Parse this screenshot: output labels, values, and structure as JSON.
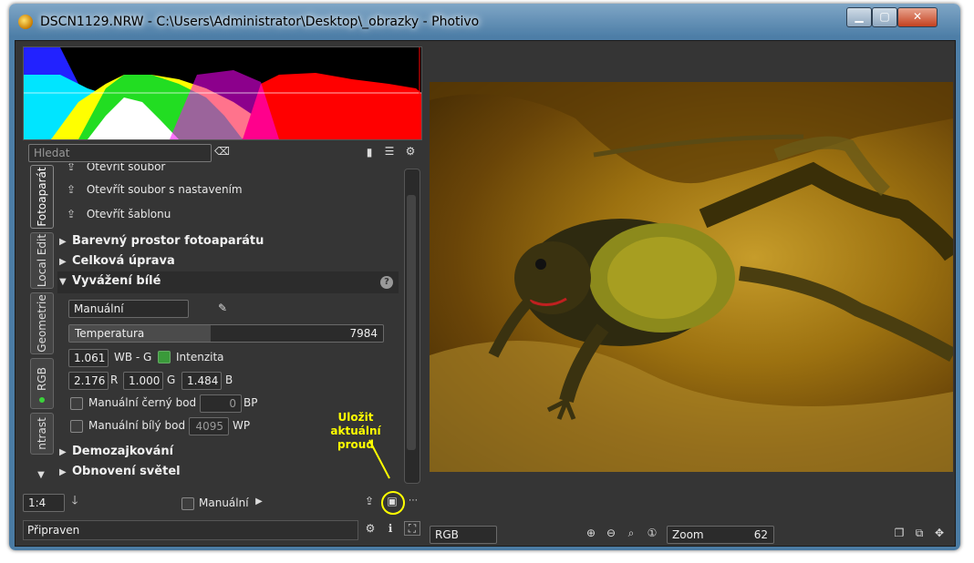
{
  "window": {
    "title": "DSCN1129.NRW - C:\\Users\\Administrator\\Desktop\\_obrazky - Photivo",
    "minimize": "▁",
    "maximize": "▢",
    "close": "✕"
  },
  "toolbar_top": {
    "search_placeholder": "Hledat"
  },
  "side_tabs": [
    "Fotoaparát",
    "Local Edit",
    "Geometrie",
    "RGB",
    "ntrast"
  ],
  "panel": {
    "open_file_partial": "Otevřít soubor",
    "open_with_settings": "Otevřít soubor s nastavením",
    "open_template": "Otevřít šablonu",
    "sections_top": [
      "Barevný prostor fotoaparátu",
      "Celková úprava"
    ],
    "white_balance": {
      "title": "Vyvážení bílé",
      "mode": "Manuální",
      "temperature_label": "Temperatura",
      "temperature_value": "7984",
      "temperature_level": 0.45,
      "wb_g_value": "1.061",
      "wb_g_label": "WB - G",
      "intensity_label": "Intenzita",
      "r_value": "2.176",
      "r_label": "R",
      "g_value": "1.000",
      "g_label": "G",
      "b_value": "1.484",
      "b_label": "B",
      "black_point_label": "Manuální černý bod",
      "black_point_value": "0",
      "black_point_unit": "BP",
      "white_point_label": "Manuální bílý bod",
      "white_point_value": "4095",
      "white_point_unit": "WP"
    },
    "sections_bottom": [
      "Demozajkování",
      "Obnovení světel"
    ]
  },
  "callout": {
    "line1": "Uložit",
    "line2": "aktuální proud"
  },
  "bottom_left": {
    "scale": "1:4",
    "manual_label": "Manuální",
    "status": "Připraven"
  },
  "bottom_right": {
    "color_space": "RGB",
    "zoom_label": "Zoom",
    "zoom_value": "62"
  },
  "colors": {
    "background": "#353535",
    "accent_callout": "#ffff00",
    "active_tab_border": "#8a8a8a"
  }
}
